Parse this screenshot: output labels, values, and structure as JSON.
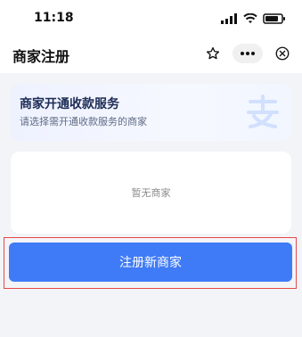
{
  "status_bar": {
    "time": "11:18"
  },
  "nav": {
    "title": "商家注册",
    "icons": [
      "star-outline-icon",
      "more-icon",
      "close-circle-icon"
    ]
  },
  "header_card": {
    "title": "商家开通收款服务",
    "subtitle": "请选择需开通收款服务的商家"
  },
  "empty_state": {
    "text": "暂无商家"
  },
  "primary_action": {
    "label": "注册新商家"
  },
  "colors": {
    "primary": "#3f7bf6",
    "highlight_border": "#e34a4a",
    "page_bg": "#f3f4f7"
  }
}
